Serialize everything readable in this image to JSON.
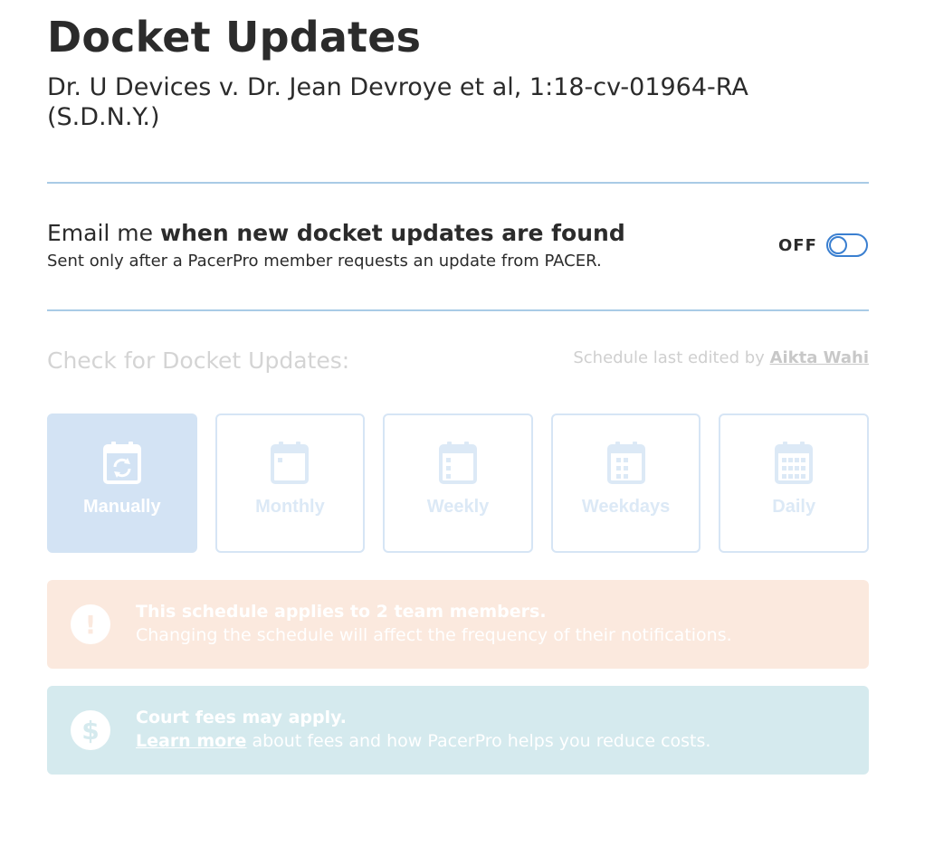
{
  "header": {
    "title": "Docket Updates",
    "case": "Dr. U Devices v. Dr. Jean Devroye et al, 1:18-cv-01964-RA (S.D.N.Y.)"
  },
  "email": {
    "prefix": "Email me ",
    "bold": "when new docket updates are found",
    "sub": "Sent only after a PacerPro member requests an update from PACER.",
    "toggle_label": "OFF"
  },
  "schedule": {
    "label": "Check for Docket Updates:",
    "edited_prefix": "Schedule last edited by ",
    "edited_by": "Aikta Wahi",
    "options": [
      {
        "label": "Manually",
        "icon": "calendar-refresh-icon",
        "selected": true
      },
      {
        "label": "Monthly",
        "icon": "calendar-monthly-icon",
        "selected": false
      },
      {
        "label": "Weekly",
        "icon": "calendar-weekly-icon",
        "selected": false
      },
      {
        "label": "Weekdays",
        "icon": "calendar-weekdays-icon",
        "selected": false
      },
      {
        "label": "Daily",
        "icon": "calendar-daily-icon",
        "selected": false
      }
    ]
  },
  "warning": {
    "icon": "exclamation-icon",
    "title": "This schedule applies to 2 team members.",
    "body": "Changing the schedule will affect the frequency of their notifications."
  },
  "fees": {
    "icon": "dollar-icon",
    "title": "Court fees may apply.",
    "link": "Learn more",
    "body": " about fees and how PacerPro helps you reduce costs."
  },
  "colors": {
    "accent": "#3a7fd0",
    "selected_option_bg": "#d3e3f4",
    "warning_bg": "#fbe9de",
    "fees_bg": "#d5eaee",
    "divider": "#a9cbe6"
  }
}
